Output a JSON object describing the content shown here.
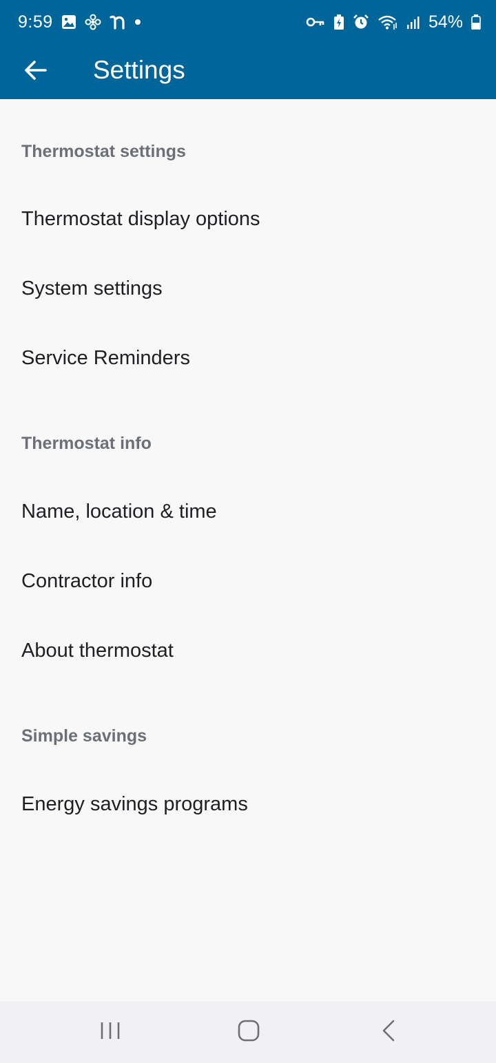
{
  "status_bar": {
    "time": "9:59",
    "battery_percent": "54%",
    "left_icons": [
      "gallery-icon",
      "fan-icon",
      "n-app-icon",
      "dot-icon"
    ],
    "right_icons": [
      "vpn-key-icon",
      "battery-saver-icon",
      "alarm-icon",
      "wifi-icon",
      "signal-icon",
      "battery-icon"
    ]
  },
  "app_bar": {
    "title": "Settings",
    "color": "#006699"
  },
  "sections": [
    {
      "header": "Thermostat settings",
      "items": [
        "Thermostat display options",
        "System settings",
        "Service Reminders"
      ]
    },
    {
      "header": "Thermostat info",
      "items": [
        "Name, location & time",
        "Contractor info",
        "About thermostat"
      ]
    },
    {
      "header": "Simple savings",
      "items": [
        "Energy savings programs"
      ]
    }
  ],
  "nav_bar": {
    "buttons": [
      "recents-icon",
      "home-icon",
      "back-icon"
    ]
  }
}
